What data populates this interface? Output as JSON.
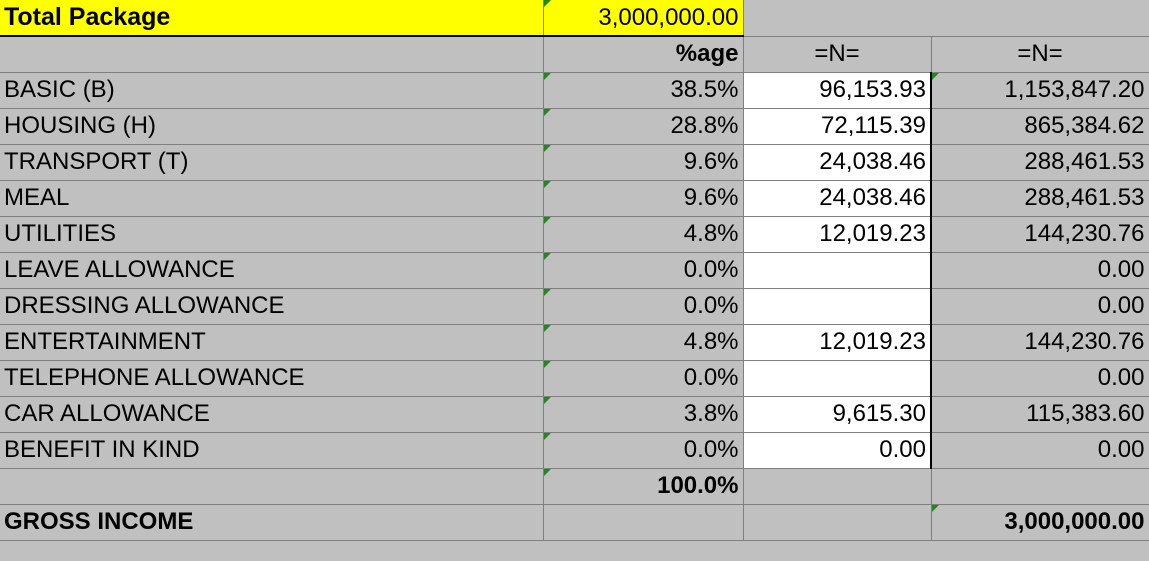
{
  "title_row": {
    "label": "Total Package",
    "value": "3,000,000.00"
  },
  "header": {
    "pct": "%age",
    "cur1": "=N=",
    "cur2": "=N="
  },
  "rows": [
    {
      "label": "BASIC (B)",
      "pct": "38.5%",
      "monthly": "96,153.93",
      "annual": "1,153,847.20"
    },
    {
      "label": "HOUSING (H)",
      "pct": "28.8%",
      "monthly": "72,115.39",
      "annual": "865,384.62"
    },
    {
      "label": "TRANSPORT (T)",
      "pct": "9.6%",
      "monthly": "24,038.46",
      "annual": "288,461.53"
    },
    {
      "label": "MEAL",
      "pct": "9.6%",
      "monthly": "24,038.46",
      "annual": "288,461.53"
    },
    {
      "label": "UTILITIES",
      "pct": "4.8%",
      "monthly": "12,019.23",
      "annual": "144,230.76"
    },
    {
      "label": "LEAVE ALLOWANCE",
      "pct": "0.0%",
      "monthly": "",
      "annual": "0.00"
    },
    {
      "label": "DRESSING ALLOWANCE",
      "pct": "0.0%",
      "monthly": "",
      "annual": "0.00"
    },
    {
      "label": "ENTERTAINMENT",
      "pct": "4.8%",
      "monthly": "12,019.23",
      "annual": "144,230.76"
    },
    {
      "label": "TELEPHONE ALLOWANCE",
      "pct": "0.0%",
      "monthly": "",
      "annual": "0.00"
    },
    {
      "label": "CAR ALLOWANCE",
      "pct": "3.8%",
      "monthly": "9,615.30",
      "annual": "115,383.60"
    },
    {
      "label": "BENEFIT IN KIND",
      "pct": "0.0%",
      "monthly": "0.00",
      "annual": "0.00"
    }
  ],
  "total_pct": "100.0%",
  "gross": {
    "label": "GROSS INCOME",
    "value": "3,000,000.00"
  },
  "colors": {
    "highlight": "#ffff00",
    "grid": "#c0c0c0",
    "error_indicator": "#1e8a1e"
  }
}
